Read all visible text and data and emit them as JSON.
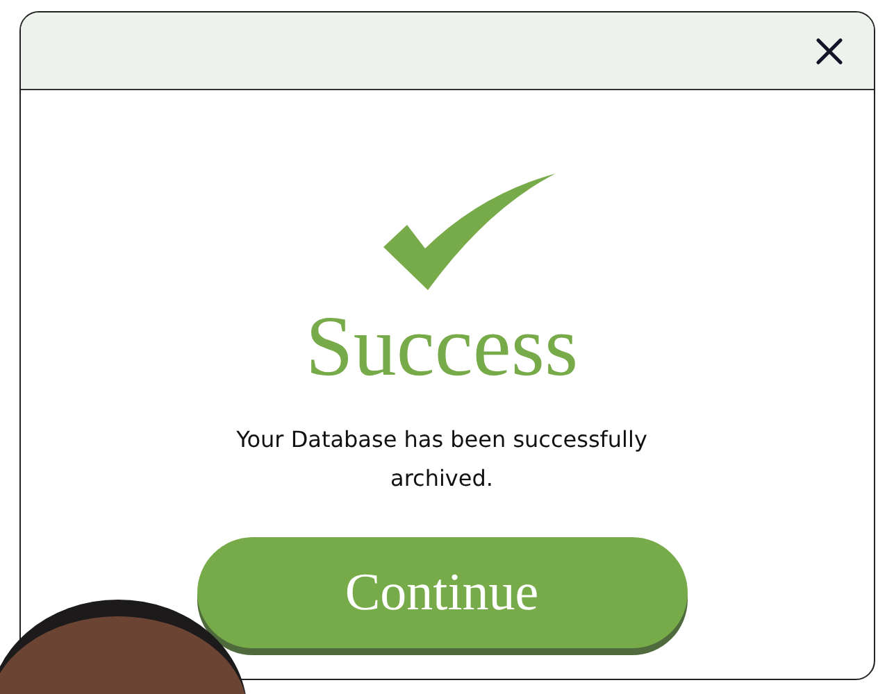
{
  "dialog": {
    "heading": "Success",
    "message": "Your Database has been successfully archived.",
    "button": "Continue"
  }
}
